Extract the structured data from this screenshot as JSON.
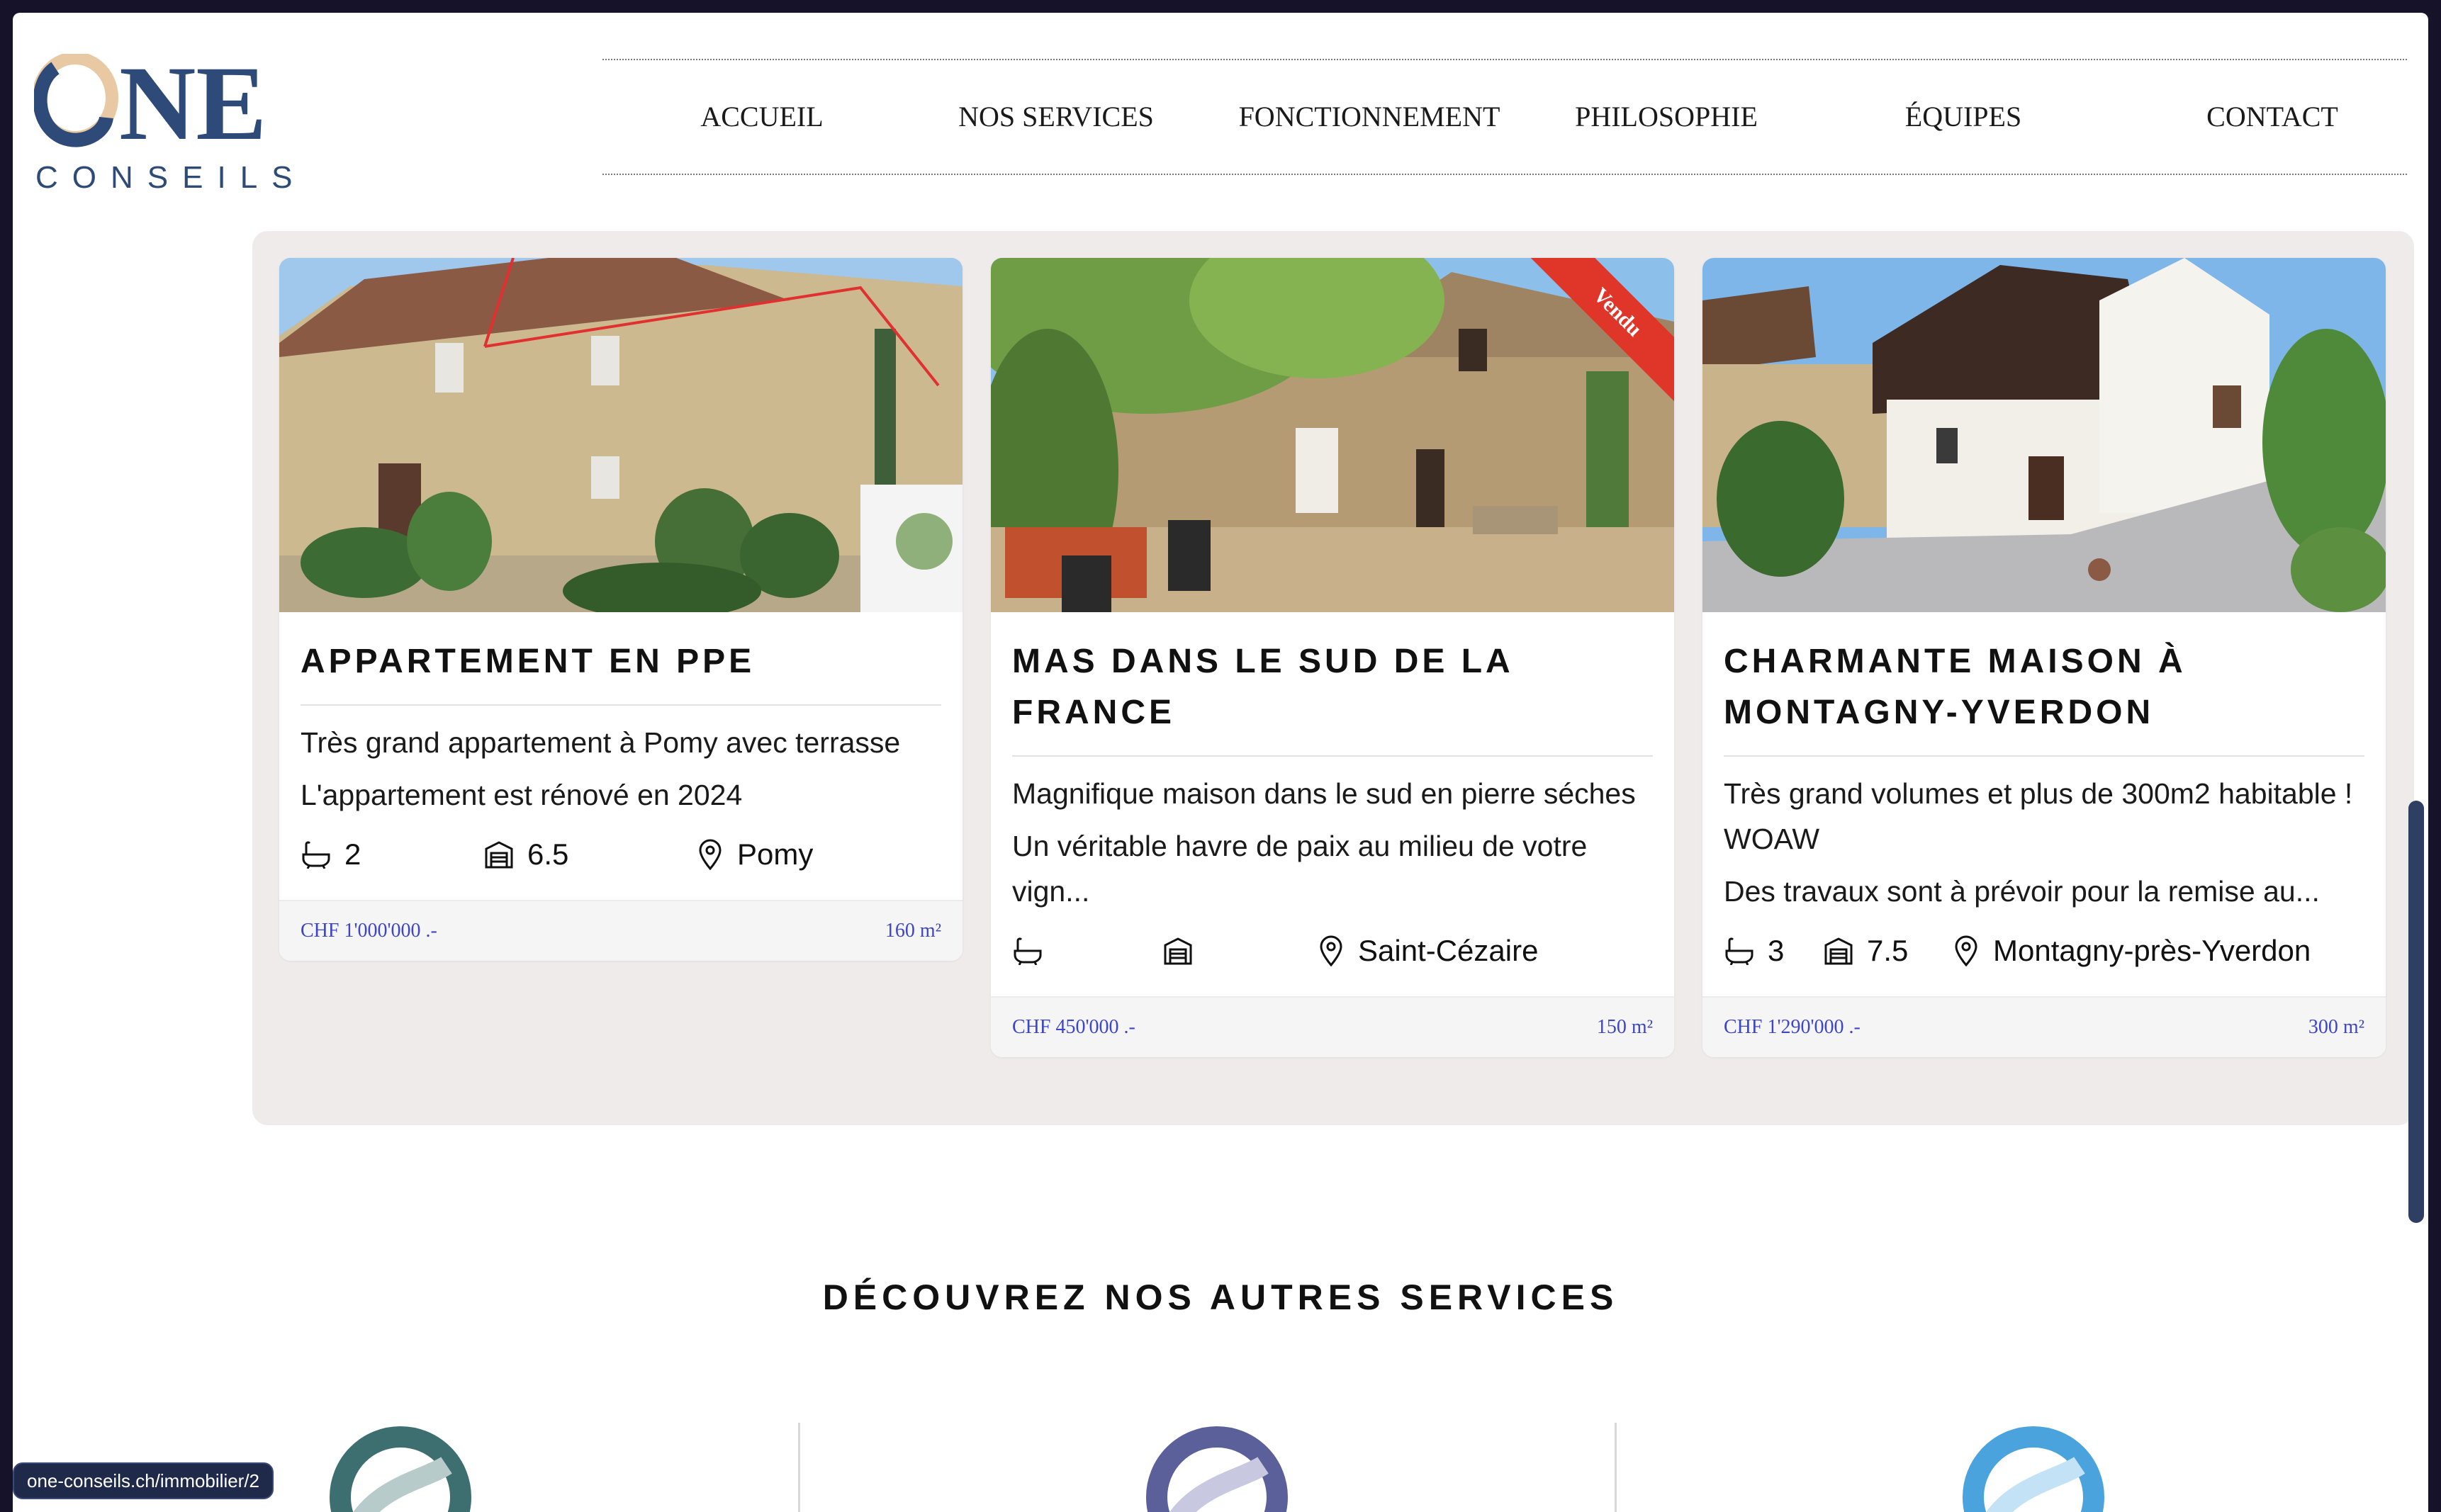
{
  "brand": {
    "logo_main": "ONE",
    "logo_sub": "CONSEILS"
  },
  "nav": {
    "items": [
      {
        "label": "ACCUEIL"
      },
      {
        "label": "NOS SERVICES"
      },
      {
        "label": "FONCTIONNEMENT"
      },
      {
        "label": "PHILOSOPHIE"
      },
      {
        "label": "ÉQUIPES"
      },
      {
        "label": "CONTACT"
      }
    ]
  },
  "listings": [
    {
      "title": "APPARTEMENT EN PPE",
      "desc1": "Très grand appartement à Pomy avec terrasse",
      "desc2": "L'appartement est rénové en 2024",
      "bathrooms": "2",
      "rooms": "6.5",
      "location": "Pomy",
      "price": "CHF 1'000'000 .-",
      "area": "160 m²"
    },
    {
      "title": "MAS DANS LE SUD DE LA FRANCE",
      "desc1": "Magnifique maison dans le sud en pierre séches",
      "desc2": "Un véritable havre de paix au milieu de votre vign...",
      "bathrooms": "",
      "rooms": "",
      "location": "Saint-Cézaire",
      "price": "CHF 450'000 .-",
      "area": "150 m²",
      "badge": "Vendu"
    },
    {
      "title": "CHARMANTE MAISON À MONTAGNY-YVERDON",
      "desc1": "Très grand volumes et plus de 300m2 habitable ! WOAW",
      "desc2": "Des travaux sont à prévoir pour la remise au...",
      "bathrooms": "3",
      "rooms": "7.5",
      "location": "Montagny-près-Yverdon",
      "price": "CHF 1'290'000 .-",
      "area": "300 m²"
    }
  ],
  "services": {
    "title": "DÉCOUVREZ NOS AUTRES SERVICES",
    "icons": [
      {
        "name": "teal-ring-icon",
        "color": "#3d6e70"
      },
      {
        "name": "indigo-ring-icon",
        "color": "#5b5f9a"
      },
      {
        "name": "sky-ring-icon",
        "color": "#4aa3dd"
      }
    ]
  },
  "status_bar": {
    "url": "one-conseils.ch/immobilier/2"
  },
  "colors": {
    "brand_blue": "#2d4a78",
    "brand_gold": "#e8c9a4",
    "price_blue": "#3d45c8",
    "ribbon_red": "#e0362a",
    "panel_bg": "#efebea"
  }
}
